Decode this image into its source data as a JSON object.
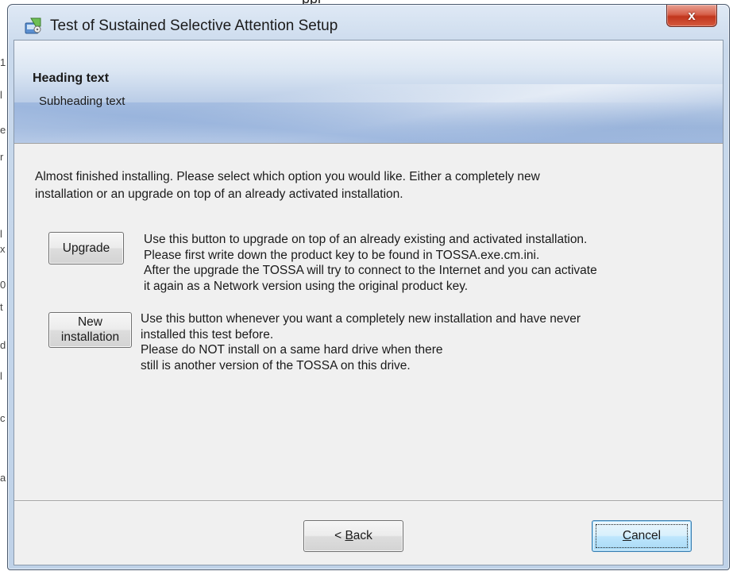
{
  "window": {
    "title": "Test of Sustained Selective Attention Setup",
    "close_label": "x"
  },
  "banner": {
    "heading": "Heading text",
    "subheading": "Subheading text"
  },
  "intro_text": "Almost finished installing. Please select which option you would like. Either a completely new\ninstallation or an upgrade on top of an already activated installation.",
  "options": {
    "upgrade": {
      "button_label": "Upgrade",
      "description": "Use this button to upgrade on top of an already existing and activated installation.\nPlease first write down the product key to be found in TOSSA.exe.cm.ini.\nAfter the upgrade the TOSSA will try to connect to the Internet and you can activate\nit again as a Network version using the original product key."
    },
    "new_installation": {
      "button_label_line1": "New",
      "button_label_line2": "installation",
      "description": "Use this button whenever you want a completely new installation and have never\ninstalled this test before.\nPlease do NOT install on a same hard drive when there\nstill is another version of the TOSSA on this drive."
    }
  },
  "footer": {
    "back_prefix": "< ",
    "back_accel": "B",
    "back_rest": "ack",
    "cancel_accel": "C",
    "cancel_rest": "ancel"
  },
  "background_fragment": {
    "top_text": "ppl",
    "left_chars": [
      "1",
      "l",
      "e",
      "r",
      "l",
      "x",
      "0",
      "t",
      "d",
      "l",
      "c",
      "a"
    ]
  },
  "colors": {
    "close_button": "#c1361d",
    "banner_blue": "#9db6da",
    "window_frame": "#c9d9ec",
    "default_button_blue": "#bee6fd"
  }
}
